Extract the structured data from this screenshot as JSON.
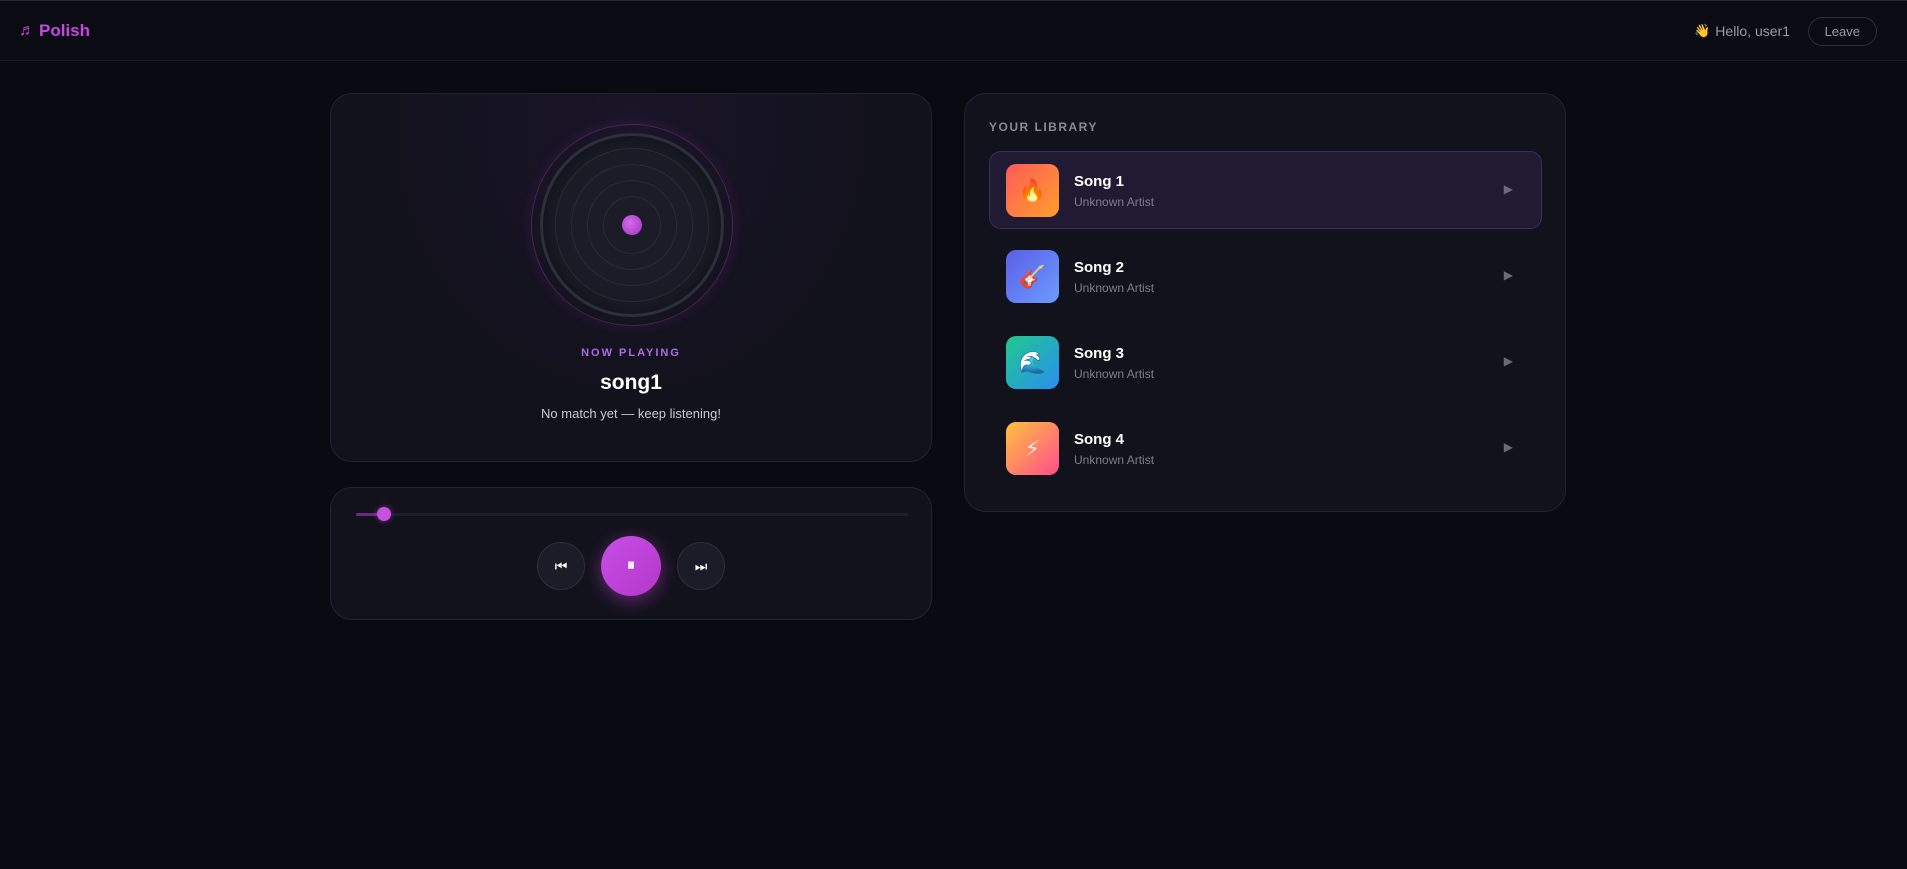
{
  "header": {
    "brand": "Polish",
    "brand_icon": "♬",
    "wave_icon": "👋",
    "greeting": "Hello, user1",
    "leave_label": "Leave"
  },
  "now_playing": {
    "label": "NOW PLAYING",
    "title": "song1",
    "status": "No match yet — keep listening!"
  },
  "player": {
    "progress_fraction": 0.05,
    "prev_icon": "⏮",
    "pause_icon": "⏸",
    "next_icon": "⏭"
  },
  "library": {
    "heading": "YOUR LIBRARY",
    "tracks": [
      {
        "title": "Song 1",
        "artist": "Unknown Artist",
        "icon": "🔥",
        "gradient": [
          "#ff5a5a",
          "#ff9e2c"
        ],
        "active": true
      },
      {
        "title": "Song 2",
        "artist": "Unknown Artist",
        "icon": "🎸",
        "gradient": [
          "#5b5fe6",
          "#6b9cff"
        ],
        "active": false
      },
      {
        "title": "Song 3",
        "artist": "Unknown Artist",
        "icon": "🌊",
        "gradient": [
          "#1ec98c",
          "#2b8ef0"
        ],
        "active": false
      },
      {
        "title": "Song 4",
        "artist": "Unknown Artist",
        "icon": "⚡",
        "gradient": [
          "#ffc23d",
          "#ff4d8d"
        ],
        "active": false
      }
    ],
    "play_icon": "▶"
  },
  "colors": {
    "accent": "#c648e0",
    "background": "#0a0a12",
    "card": "#12121c"
  }
}
